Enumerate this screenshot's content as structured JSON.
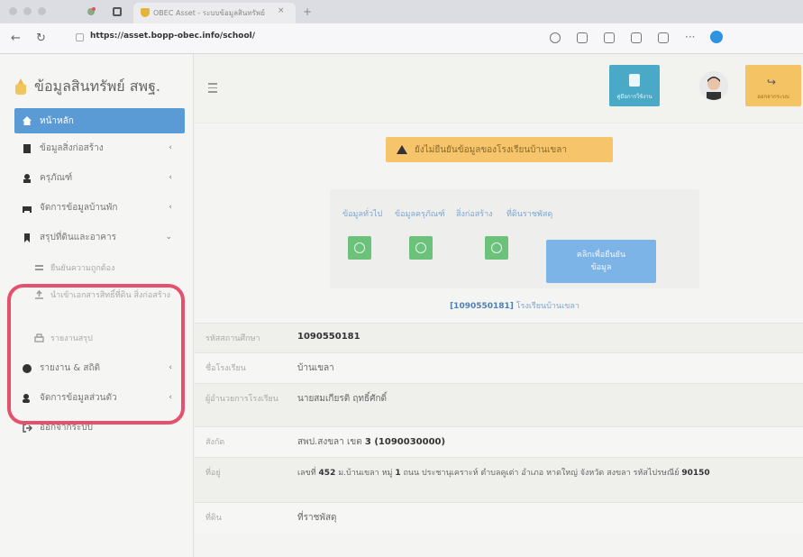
{
  "browser": {
    "tab_title": "OBEC Asset - ระบบข้อมูลสินทรัพย์",
    "tab_close": "×",
    "new_tab": "+",
    "url": "https://asset.bopp-obec.info/school/"
  },
  "sidebar": {
    "brand": "ข้อมูลสินทรัพย์ สพฐ.",
    "items": [
      {
        "label": "หน้าหลัก",
        "active": true
      },
      {
        "label": "ข้อมูลสิ่งก่อสร้าง",
        "chev": "‹"
      },
      {
        "label": "ครุภัณฑ์",
        "chev": "‹"
      },
      {
        "label": "จัดการข้อมูลบ้านพัก",
        "chev": "‹"
      },
      {
        "label": "สรุปที่ดินและอาคาร",
        "chev": "⌄"
      },
      {
        "label": "ยืนยันความถูกต้อง",
        "sub": true
      },
      {
        "label": "นำเข้าเอกสารสิทธิ์ที่ดิน สิ่งก่อสร้าง",
        "sub": true
      },
      {
        "label": "รายงานสรุป",
        "sub": true
      },
      {
        "label": "รายงาน & สถิติ",
        "chev": "‹"
      },
      {
        "label": "จัดการข้อมูลส่วนตัว",
        "chev": "‹"
      },
      {
        "label": "ออกจากระบบ"
      }
    ]
  },
  "header": {
    "manual_label": "คู่มือการใช้งาน",
    "logout_label": "ออกจากระบบ"
  },
  "alert": {
    "text": "ยังไม่ยืนยันข้อมูลของโรงเรียนบ้านเขลา"
  },
  "status": {
    "labels": [
      "ข้อมูลทั่วไป",
      "ข้อมูลครุภัณฑ์",
      "สิ่งก่อสร้าง",
      "ที่ดินราชพัสดุ"
    ],
    "confirm_line1": "คลิกเพื่อยืนยัน",
    "confirm_line2": "ข้อมูล",
    "school_code": "[1090550181]",
    "school_name": "โรงเรียนบ้านเขลา"
  },
  "info": {
    "rows": [
      {
        "key": "รหัสสถานศึกษา",
        "value": "1090550181",
        "bold": true
      },
      {
        "key": "ชื่อโรงเรียน",
        "value": "บ้านเขลา"
      },
      {
        "key": "ผู้อำนวยการโรงเรียน",
        "value": "นายสมเกียรติ ฤทธิ์ศักดิ์"
      },
      {
        "key": "สังกัด",
        "value_prefix": "สพป.สงขลา เขต ",
        "value_bold": "3 (1090030000)"
      },
      {
        "key": "ที่อยู่",
        "value_prefix": "เลขที่ ",
        "value_bold": "452",
        "value_mid": " ม.บ้านเขลา หมู่ ",
        "value_bold2": "1",
        "value_suffix": " ถนน ประชานุเคราะห์ ตำบลคูเต่า อำเภอ หาดใหญ่ จังหวัด สงขลา รหัสไปรษณีย์ ",
        "value_bold3": "90150"
      },
      {
        "key": "ที่ดิน",
        "value": "ที่ราชพัสดุ"
      }
    ]
  },
  "colors": {
    "active_blue": "#5b9bd5",
    "alert_orange": "#f5c46b",
    "success_green": "#6cc27a",
    "highlight_red": "#e5506d"
  }
}
